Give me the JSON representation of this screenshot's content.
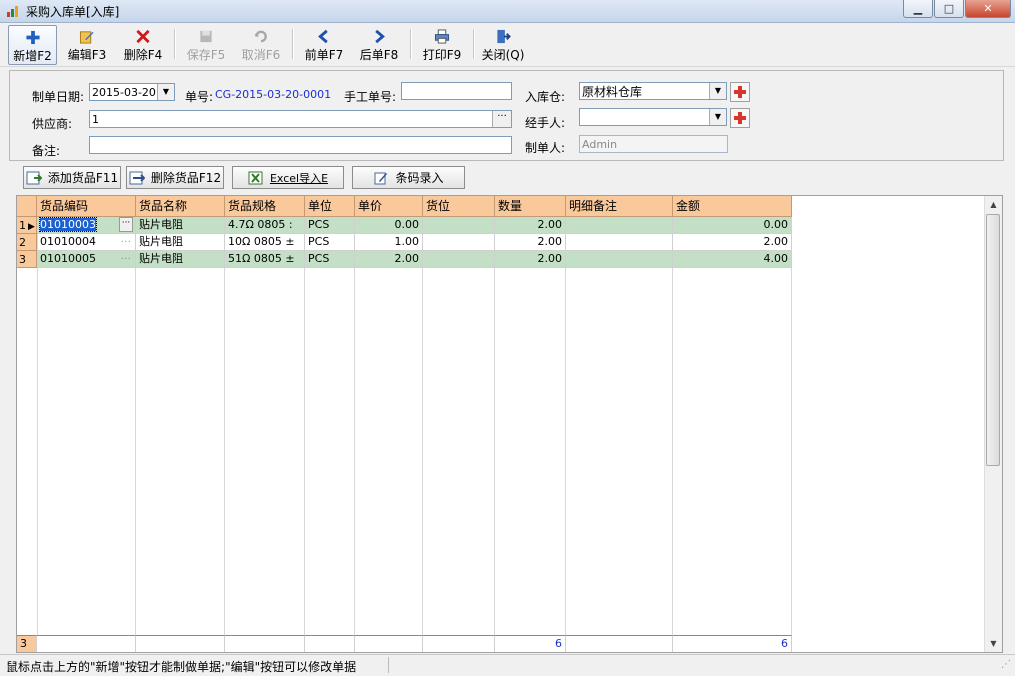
{
  "window": {
    "title": "采购入库单[入库]"
  },
  "toolbar": {
    "new": "新增F2",
    "edit": "编辑F3",
    "delete": "删除F4",
    "save": "保存F5",
    "cancel": "取消F6",
    "prev": "前单F7",
    "next": "后单F8",
    "print": "打印F9",
    "close": "关闭(Q)"
  },
  "form": {
    "date_label": "制单日期:",
    "date_value": "2015-03-20",
    "order_no_label": "单号:",
    "order_no_value": "CG-2015-03-20-0001",
    "manual_no_label": "手工单号:",
    "manual_no_value": "",
    "warehouse_label": "入库仓:",
    "warehouse_value": "原材料仓库",
    "supplier_label": "供应商:",
    "supplier_value": "1",
    "handler_label": "经手人:",
    "handler_value": "",
    "remark_label": "备注:",
    "remark_value": "",
    "creator_label": "制单人:",
    "creator_value": "Admin"
  },
  "actions": {
    "add_goods": "添加货品F11",
    "delete_goods": "删除货品F12",
    "excel_import": "Excel导入E",
    "barcode": "条码录入"
  },
  "grid": {
    "columns": [
      "货品编码",
      "货品名称",
      "货品规格",
      "单位",
      "单价",
      "货位",
      "数量",
      "明细备注",
      "金额"
    ],
    "rows": [
      {
        "no": "1",
        "code": "01010003",
        "name": "贴片电阻",
        "spec": "4.7Ω   0805  :",
        "unit": "PCS",
        "price": "0.00",
        "loc": "",
        "qty": "2.00",
        "note": "",
        "amount": "0.00"
      },
      {
        "no": "2",
        "code": "01010004",
        "name": "贴片电阻",
        "spec": "10Ω    0805  ±",
        "unit": "PCS",
        "price": "1.00",
        "loc": "",
        "qty": "2.00",
        "note": "",
        "amount": "2.00"
      },
      {
        "no": "3",
        "code": "01010005",
        "name": "贴片电阻",
        "spec": "51Ω    0805  ±",
        "unit": "PCS",
        "price": "2.00",
        "loc": "",
        "qty": "2.00",
        "note": "",
        "amount": "4.00"
      }
    ],
    "footer": {
      "count": "3",
      "qty_total": "6",
      "amount_total": "6"
    }
  },
  "status": {
    "text": "鼠标点击上方的\"新增\"按钮才能制做单据;\"编辑\"按钮可以修改单据"
  },
  "colors": {
    "header": "#f9c99c",
    "row_alt": "#c3e0c6",
    "accent_blue": "#1b2fd0"
  }
}
